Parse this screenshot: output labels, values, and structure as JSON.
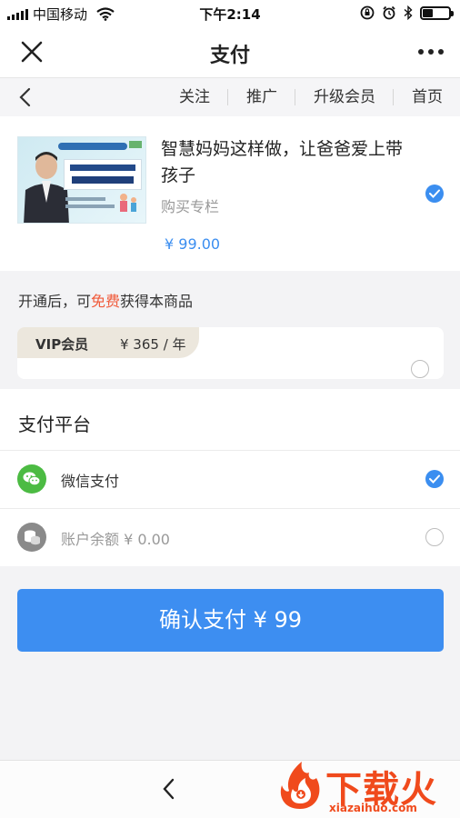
{
  "status_bar": {
    "carrier": "中国移动",
    "time": "下午2:14"
  },
  "nav": {
    "title": "支付"
  },
  "sub_nav": {
    "links": [
      "关注",
      "推广",
      "升级会员",
      "首页"
    ]
  },
  "product": {
    "title": "智慧妈妈这样做，让爸爸爱上带孩子",
    "subtitle": "购买专栏",
    "price": "¥ 99.00",
    "selected": true
  },
  "vip": {
    "note_before": "开通后，可",
    "note_highlight": "免费",
    "note_after": "获得本商品",
    "name": "VIP会员",
    "price": "¥ 365 / 年",
    "selected": false
  },
  "payment": {
    "title": "支付平台",
    "options": [
      {
        "label": "微信支付",
        "icon": "wechat-pay-icon",
        "selected": true
      },
      {
        "label": "账户余额 ¥ 0.00",
        "icon": "coins-icon",
        "selected": false
      }
    ]
  },
  "confirm_button": {
    "label": "确认支付 ¥ 99"
  },
  "watermark": {
    "text": "下载火",
    "site": "xiazaihuo.com"
  },
  "colors": {
    "accent": "#3d8ef1",
    "price": "#3b8ef0",
    "highlight": "#f05a3a",
    "wechat_green": "#4cbb43",
    "watermark": "#f04a1c"
  }
}
